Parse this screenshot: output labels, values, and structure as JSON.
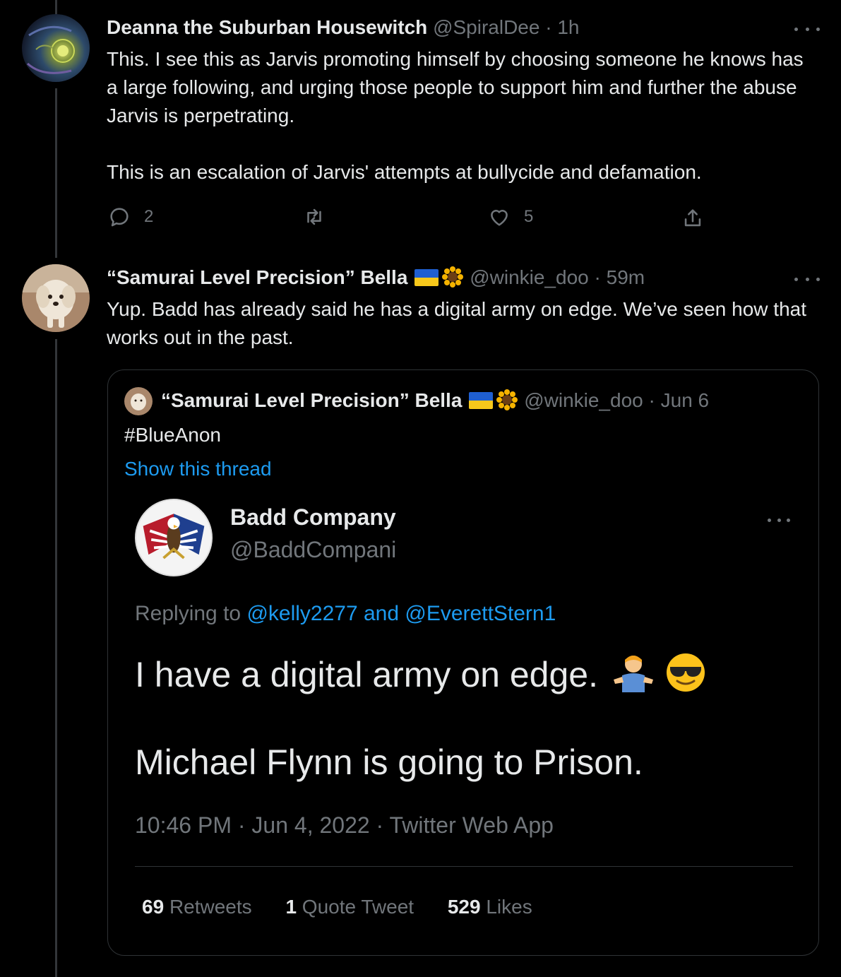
{
  "tweet1": {
    "display_name": "Deanna the Suburban Housewitch",
    "handle": "@SpiralDee",
    "separator": "·",
    "time": "1h",
    "text": "This. I see this as Jarvis promoting himself by choosing someone he knows has a large following, and urging those people to support him and further the abuse Jarvis is perpetrating.\n\nThis is an escalation of Jarvis' attempts at bullycide and defamation.",
    "reply_count": "2",
    "like_count": "5"
  },
  "tweet2": {
    "display_name": "“Samurai Level Precision” Bella",
    "handle": "@winkie_doo",
    "separator": "·",
    "time": "59m",
    "text": "Yup. Badd has already said he has a digital army on edge. We’ve seen how that works out in the past."
  },
  "quoted": {
    "display_name": "“Samurai Level Precision” Bella",
    "handle": "@winkie_doo",
    "separator": "·",
    "time": "Jun 6",
    "text": "#BlueAnon",
    "show_thread": "Show this thread"
  },
  "screenshot": {
    "display_name": "Badd Company",
    "handle": "@BaddCompani",
    "replying_prefix": "Replying to",
    "reply_user1": "@kelly2277",
    "reply_and": "and",
    "reply_user2": "@EverettStern1",
    "line1": "I have a digital army on edge.",
    "line2": "Michael Flynn is going to Prison.",
    "timestamp": "10:46 PM · Jun 4, 2022 · Twitter Web App",
    "retweets_count": "69",
    "retweets_label": "Retweets",
    "quotes_count": "1",
    "quotes_label": "Quote Tweet",
    "likes_count": "529",
    "likes_label": "Likes"
  },
  "colors": {
    "background": "#000000",
    "text": "#e7e9ea",
    "muted": "#71767b",
    "link": "#1d9bf0",
    "border": "#2f3336"
  },
  "icons": [
    "reply-icon",
    "retweet-icon",
    "like-icon",
    "share-icon",
    "more-icon",
    "ukraine-flag-icon",
    "sunflower-icon",
    "shrug-emoji",
    "sunglasses-emoji"
  ]
}
